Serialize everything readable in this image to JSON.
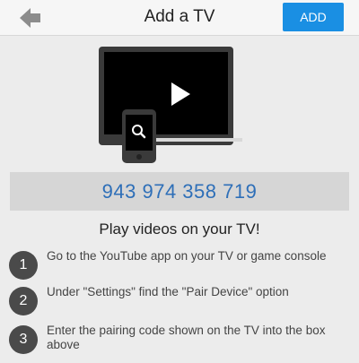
{
  "header": {
    "title": "Add a TV",
    "add_label": "ADD"
  },
  "pairing_code": "943 974 358 719",
  "subtitle": "Play videos on your TV!",
  "steps": [
    {
      "number": "1",
      "text": "Go to the YouTube app on your TV or game console"
    },
    {
      "number": "2",
      "text": "Under \"Settings\" find the \"Pair Device\" option"
    },
    {
      "number": "3",
      "text": "Enter the pairing code shown on the TV into the box above"
    }
  ],
  "colors": {
    "accent": "#1a8fe3",
    "code_text": "#2e6fb8",
    "step_circle": "#4a4a4a"
  },
  "icons": {
    "back": "back-arrow-icon",
    "illustration": "tv-with-phone-illustration",
    "play": "play-icon",
    "search": "search-icon"
  }
}
